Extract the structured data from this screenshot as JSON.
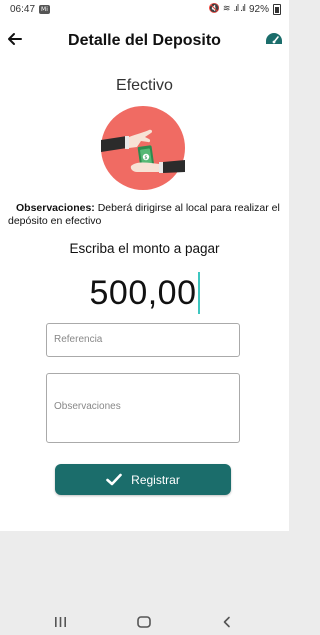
{
  "status_bar": {
    "time": "06:47",
    "notification_chip": "Mi",
    "battery": "92%"
  },
  "header": {
    "title": "Detalle del Deposito"
  },
  "payment": {
    "method": "Efectivo",
    "observations_label": "Observaciones:",
    "observations_text": "Deberá dirigirse al local para realizar el depósito en efectivo"
  },
  "amount": {
    "prompt": "Escriba el monto a pagar",
    "value": "500,00"
  },
  "form": {
    "reference_placeholder": "Referencia",
    "observations_placeholder": "Observaciones",
    "submit_label": "Registrar"
  },
  "colors": {
    "accent": "#1b6d6b",
    "illustration_bg": "#f06b63",
    "cursor": "#3ec6c0"
  },
  "icons": [
    "back-arrow-icon",
    "dashboard-gauge-icon",
    "check-icon",
    "recent-apps-icon",
    "home-icon",
    "back-nav-icon"
  ]
}
